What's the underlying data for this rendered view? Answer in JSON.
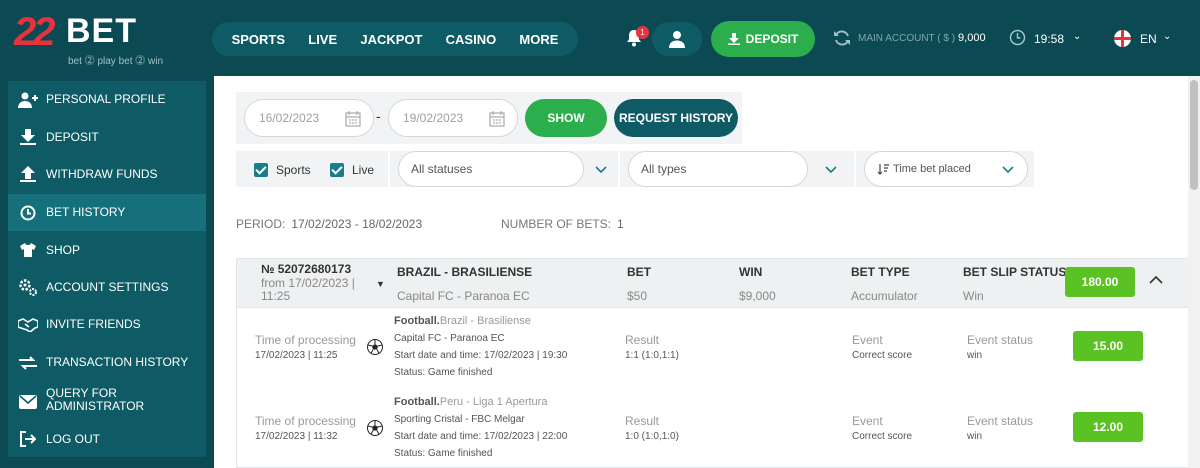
{
  "brand": {
    "logo_num": "22",
    "logo_word": "BET",
    "tagline": "bet ⓶ play  bet ⓶ win"
  },
  "topnav": [
    "SPORTS",
    "LIVE",
    "JACKPOT",
    "CASINO",
    "MORE"
  ],
  "header": {
    "notification_count": "1",
    "deposit_label": "DEPOSIT",
    "account_label": "MAIN ACCOUNT ( $ )",
    "account_balance": "9,000",
    "time": "19:58",
    "language": "EN"
  },
  "sidebar": {
    "items": [
      {
        "label": "PERSONAL PROFILE",
        "icon": "user-plus-icon"
      },
      {
        "label": "DEPOSIT",
        "icon": "download-icon"
      },
      {
        "label": "WITHDRAW FUNDS",
        "icon": "upload-icon"
      },
      {
        "label": "BET HISTORY",
        "icon": "clock-icon",
        "active": true
      },
      {
        "label": "SHOP",
        "icon": "shirt-icon"
      },
      {
        "label": "ACCOUNT SETTINGS",
        "icon": "gears-icon"
      },
      {
        "label": "INVITE FRIENDS",
        "icon": "handshake-icon"
      },
      {
        "label": "TRANSACTION HISTORY",
        "icon": "exchange-icon"
      },
      {
        "label": "QUERY FOR ADMINISTRATOR",
        "icon": "envelope-icon"
      },
      {
        "label": "LOG OUT",
        "icon": "logout-icon"
      }
    ]
  },
  "filters": {
    "date_from": "16/02/2023",
    "date_to": "19/02/2023",
    "date_sep": "-",
    "show_label": "SHOW",
    "request_history_label": "REQUEST HISTORY",
    "sports_label": "Sports",
    "live_label": "Live",
    "status_select": "All statuses",
    "type_select": "All types",
    "sort_select": "Time bet placed"
  },
  "summary": {
    "period_label": "PERIOD:",
    "period_value": "17/02/2023 - 18/02/2023",
    "num_bets_label": "NUMBER OF BETS:",
    "num_bets_value": "1"
  },
  "bet": {
    "number": "№ 52072680173",
    "from": "from 17/02/2023 | 11:25",
    "league_label": "BRAZIL - BRASILIENSE",
    "league_value": "Capital FC - Paranoa EC",
    "bet_label": "BET",
    "bet_value": "$50",
    "win_label": "WIN",
    "win_value": "$9,000",
    "type_label": "BET TYPE",
    "type_value": "Accumulator",
    "status_label": "BET SLIP STATUS",
    "status_value": "Win",
    "total_coef": "180.00",
    "events": [
      {
        "proc_label": "Time of processing",
        "proc_value": "17/02/2023 | 11:25",
        "sport": "Football.",
        "league": "Brazil - Brasiliense",
        "match": "Capital FC - Paranoa EC",
        "start": "Start date and time: 17/02/2023 | 19:30",
        "status": "Status: Game finished",
        "result_label": "Result",
        "result_value": "1:1 (1:0,1:1)",
        "event_label": "Event",
        "event_value": "Correct score",
        "estatus_label": "Event status",
        "estatus_value": "win",
        "coef": "15.00"
      },
      {
        "proc_label": "Time of processing",
        "proc_value": "17/02/2023 | 11:32",
        "sport": "Football.",
        "league": "Peru - Liga 1 Apertura",
        "match": "Sporting Cristal - FBC Melgar",
        "start": "Start date and time: 17/02/2023 | 22:00",
        "status": "Status: Game finished",
        "result_label": "Result",
        "result_value": "1:0 (1:0,1:0)",
        "event_label": "Event",
        "event_value": "Correct score",
        "estatus_label": "Event status",
        "estatus_value": "win",
        "coef": "12.00"
      }
    ]
  },
  "colors": {
    "header_bg": "#0b4a53",
    "panel": "#0f5b65",
    "green": "#2cae4c",
    "coef_green": "#5bc223",
    "brand_red": "#e8333f"
  }
}
